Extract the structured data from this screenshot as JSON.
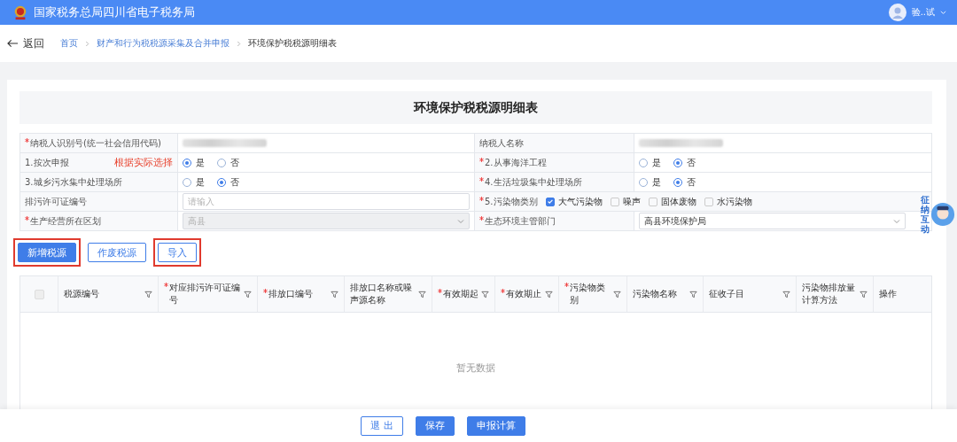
{
  "header": {
    "title": "国家税务总局四川省电子税务局",
    "user": "验..试"
  },
  "nav": {
    "back": "返回",
    "breadcrumb": [
      {
        "label": "首页",
        "current": false
      },
      {
        "label": "财产和行为税税源采集及合并申报",
        "current": false
      },
      {
        "label": "环境保护税税源明细表",
        "current": true
      }
    ]
  },
  "form": {
    "title": "环境保护税税源明细表",
    "fields": [
      {
        "label": "纳税人识别号(统一社会信用代码)",
        "required": true,
        "kind": "redacted"
      },
      {
        "label": "纳税人名称",
        "required": false,
        "kind": "redacted"
      },
      {
        "label": "1.按次申报",
        "required": false,
        "note": "根据实际选择",
        "kind": "radio",
        "options": [
          {
            "label": "是",
            "selected": true
          },
          {
            "label": "否",
            "selected": false
          }
        ]
      },
      {
        "label": "2.从事海洋工程",
        "required": true,
        "kind": "radio",
        "options": [
          {
            "label": "是",
            "selected": false
          },
          {
            "label": "否",
            "selected": true
          }
        ]
      },
      {
        "label": "3.城乡污水集中处理场所",
        "required": false,
        "kind": "radio",
        "options": [
          {
            "label": "是",
            "selected": false
          },
          {
            "label": "否",
            "selected": true
          }
        ]
      },
      {
        "label": "4.生活垃圾集中处理场所",
        "required": true,
        "kind": "radio",
        "options": [
          {
            "label": "是",
            "selected": false
          },
          {
            "label": "否",
            "selected": true
          }
        ]
      },
      {
        "label": "排污许可证编号",
        "required": false,
        "kind": "input",
        "placeholder": "请输入"
      },
      {
        "label": "5.污染物类别",
        "required": true,
        "kind": "checkboxes",
        "options": [
          {
            "label": "大气污染物",
            "checked": true
          },
          {
            "label": "噪声",
            "checked": false
          },
          {
            "label": "固体废物",
            "checked": false
          },
          {
            "label": "水污染物",
            "checked": false
          }
        ]
      },
      {
        "label": "生产经营所在区划",
        "required": true,
        "kind": "select",
        "value": "高县",
        "disabled": true
      },
      {
        "label": "生态环境主管部门",
        "required": true,
        "kind": "select",
        "value": "高县环境保护局",
        "disabled": false
      }
    ]
  },
  "actions": [
    {
      "label": "新增税源",
      "kind": "primary",
      "highlighted": true
    },
    {
      "label": "作废税源",
      "kind": "plain",
      "highlighted": false
    },
    {
      "label": "导入",
      "kind": "plain",
      "highlighted": true
    }
  ],
  "table": {
    "select_all_checked": false,
    "columns": [
      {
        "label": "税源编号",
        "required": false,
        "filter": true
      },
      {
        "label": "对应排污许可证编号",
        "required": true,
        "filter": true
      },
      {
        "label": "排放口编号",
        "required": true,
        "filter": true
      },
      {
        "label": "排放口名称或噪声源名称",
        "required": false,
        "filter": true
      },
      {
        "label": "有效期起",
        "required": true,
        "filter": true
      },
      {
        "label": "有效期止",
        "required": true,
        "filter": true
      },
      {
        "label": "污染物类别",
        "required": true,
        "filter": true
      },
      {
        "label": "污染物名称",
        "required": false,
        "filter": true
      },
      {
        "label": "征收子目",
        "required": false,
        "filter": true
      },
      {
        "label": "污染物排放量计算方法",
        "required": false,
        "filter": true
      },
      {
        "label": "操作",
        "required": false,
        "filter": false
      }
    ],
    "empty": "暂无数据"
  },
  "footer": {
    "buttons": [
      {
        "label": "退 出",
        "kind": "plain"
      },
      {
        "label": "保存",
        "kind": "primary"
      },
      {
        "label": "申报计算",
        "kind": "primary"
      }
    ]
  },
  "assistant": {
    "label": "征纳互动"
  }
}
